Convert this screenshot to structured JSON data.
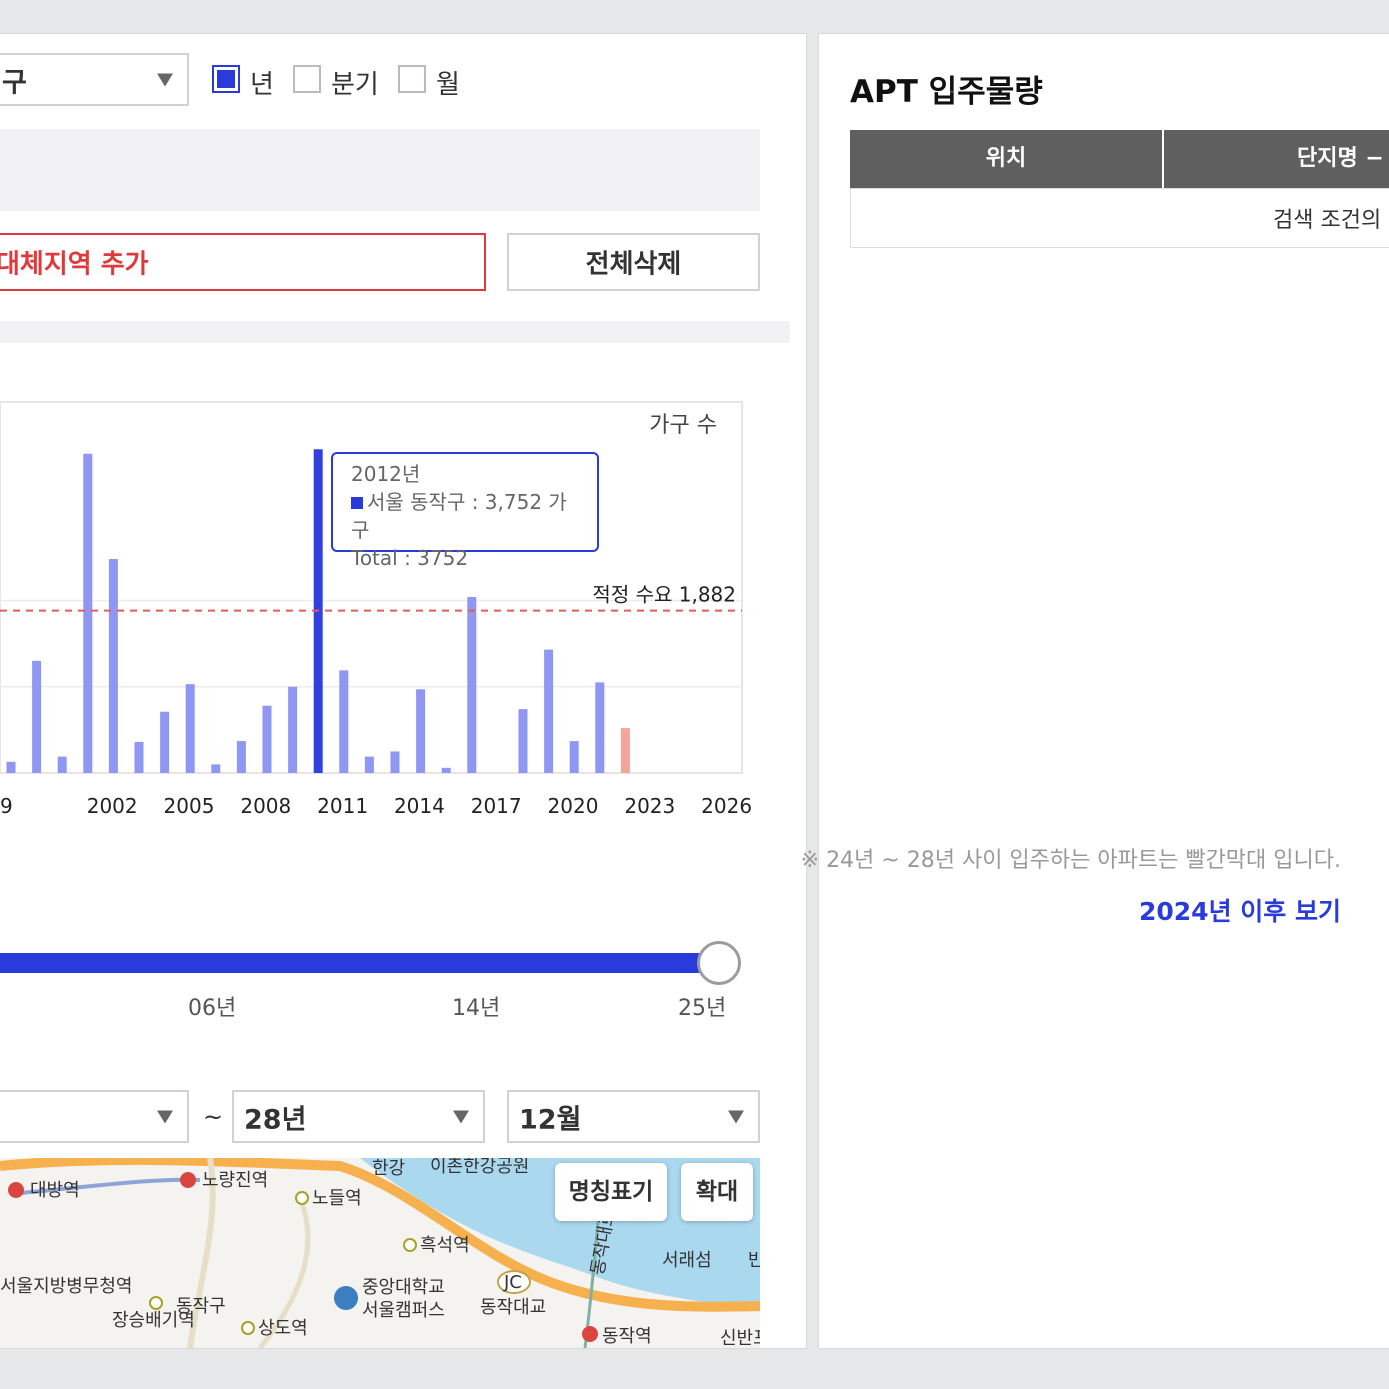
{
  "filters": {
    "region_select_value": "구",
    "period_options": [
      {
        "label": "년",
        "checked": true
      },
      {
        "label": "분기",
        "checked": false
      },
      {
        "label": "월",
        "checked": false
      }
    ],
    "add_alt_region_label": "대체지역 추가",
    "delete_all_label": "전체삭제"
  },
  "chart_data": {
    "type": "bar",
    "unit_label": "가구 수",
    "x_ticks": [
      "9",
      "2002",
      "2005",
      "2008",
      "2011",
      "2014",
      "2017",
      "2020",
      "2023",
      "2026"
    ],
    "x": [
      2000,
      2001,
      2002,
      2003,
      2004,
      2005,
      2006,
      2007,
      2008,
      2009,
      2010,
      2011,
      2012,
      2013,
      2014,
      2015,
      2016,
      2017,
      2018,
      2019,
      2020,
      2021,
      2022,
      2023,
      2024
    ],
    "values": [
      130,
      1300,
      190,
      3700,
      2480,
      360,
      710,
      1030,
      100,
      370,
      780,
      1000,
      3752,
      1190,
      190,
      250,
      970,
      60,
      2040,
      0,
      740,
      1430,
      370,
      1050,
      520
    ],
    "highlight_year": 2012,
    "future_years": [
      2024
    ],
    "reference_line": {
      "label": "적정 수요 1,882",
      "value": 1882
    },
    "ylim": [
      0,
      4300
    ],
    "colors": {
      "normal": "#8f96f3",
      "highlight": "#3140e0",
      "future": "#f5a49c",
      "reference": "#e45b5b"
    }
  },
  "tooltip": {
    "year": "2012년",
    "series_line": "서울 동작구 : 3,752 가구",
    "total_line": "Total : 3752"
  },
  "note": "※ 24년 ~ 28년 사이 입주하는 아파트는 빨간막대 입니다.",
  "after_link": "2024년 이후 보기",
  "slider": {
    "labels": [
      "06년",
      "14년",
      "25년"
    ],
    "position": 1.0
  },
  "range": {
    "end_year": "28년",
    "end_month": "12월",
    "separator": "~"
  },
  "map": {
    "buttons": {
      "names": "명칭표기",
      "zoom": "확대"
    },
    "labels": {
      "daebang": "대방역",
      "noryangjin": "노량진역",
      "hangang": "한강",
      "ichon_park": "이촌한강공원",
      "nodeul": "노들역",
      "heukseok": "흑석역",
      "seorae": "서래섬",
      "military": "서울지방병무청역",
      "dongjak_gu": "동작구",
      "jangseungbaegi": "장승배기역",
      "sangdo": "상도역",
      "cau1": "중앙대학교",
      "cau2": "서울캠퍼스",
      "jc": "JC",
      "dongjak_bridge": "동작대교",
      "dongjak_station": "동작역",
      "sinban": "신반포",
      "dongjak_road": "동작대로",
      "edge_label": "반"
    }
  },
  "right": {
    "title": "APT 입주물량",
    "headers": [
      "위치",
      "단지명 −"
    ],
    "empty_message": "검색 조건의"
  }
}
